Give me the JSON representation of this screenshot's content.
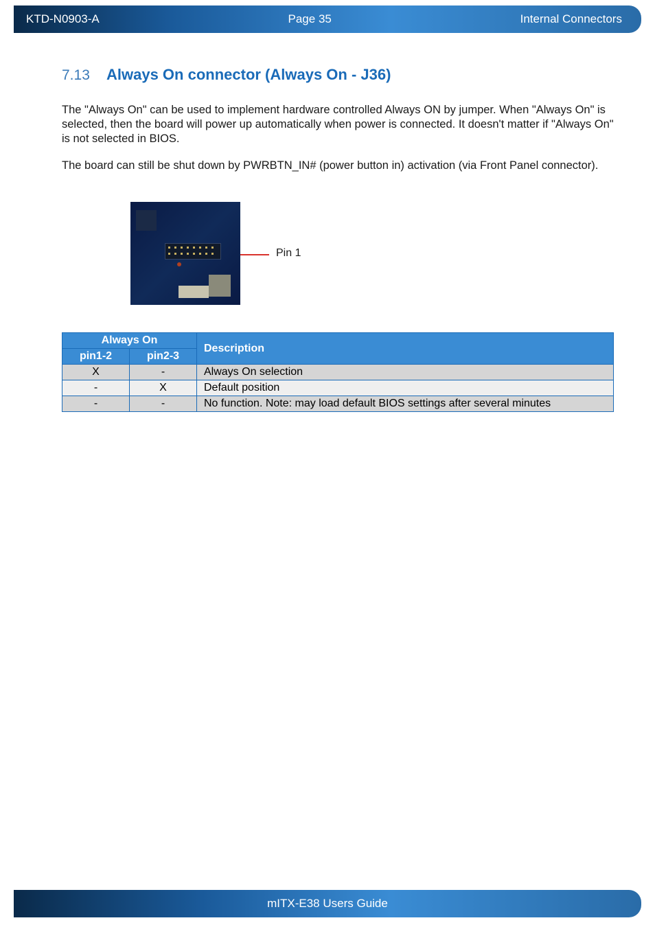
{
  "header": {
    "left": "KTD-N0903-A",
    "center": "Page 35",
    "right": "Internal Connectors"
  },
  "section": {
    "number": "7.13",
    "title": "Always On connector (Always On - J36)"
  },
  "paragraphs": {
    "p1": "The \"Always On\" can be used to implement hardware controlled Always ON by jumper. When \"Always On\" is selected, then the board will power up automatically when power is connected. It doesn't matter if \"Always On\" is not selected in BIOS.",
    "p2": "The board can still be shut down by PWRBTN_IN# (power button in) activation (via Front Panel connector)."
  },
  "pin_label": "Pin 1",
  "table": {
    "group_header": "Always On",
    "col_pin12": "pin1-2",
    "col_pin23": "pin2-3",
    "col_desc": "Description",
    "rows": [
      {
        "pin12": "X",
        "pin23": "-",
        "desc": "Always On selection"
      },
      {
        "pin12": "-",
        "pin23": "X",
        "desc": "Default position"
      },
      {
        "pin12": "-",
        "pin23": "-",
        "desc": "No function. Note: may load default BIOS settings after several minutes"
      }
    ]
  },
  "footer": {
    "title": "mITX-E38 Users Guide"
  }
}
